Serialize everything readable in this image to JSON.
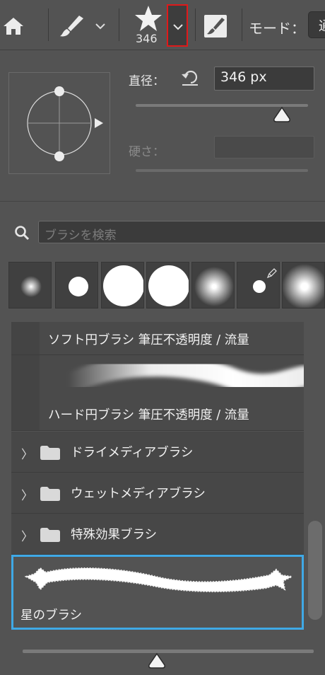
{
  "toolbar": {
    "preset_size": "346",
    "mode_label": "モード：",
    "mode_value": "通"
  },
  "brush_settings": {
    "size_label": "直径：",
    "size_value": "346 px",
    "size_slider_fraction": 0.85,
    "hardness_label": "硬さ：",
    "hardness_value": ""
  },
  "search": {
    "placeholder": "ブラシを検索"
  },
  "thumbnails": [
    {
      "name": "soft-round-small"
    },
    {
      "name": "hard-round-small"
    },
    {
      "name": "hard-round-large"
    },
    {
      "name": "hard-round-large-2"
    },
    {
      "name": "soft-round-medium"
    },
    {
      "name": "pressure-round"
    },
    {
      "name": "soft-round-large"
    }
  ],
  "presets": {
    "soft_round": "ソフト円ブラシ 筆圧不透明度 / 流量",
    "hard_round": "ハード円ブラシ 筆圧不透明度 / 流量",
    "groups": [
      {
        "label": "ドライメディアブラシ"
      },
      {
        "label": "ウェットメディアブラシ"
      },
      {
        "label": "特殊効果ブラシ"
      }
    ],
    "selected": "星のブラシ"
  },
  "colors": {
    "selection": "#3fa9e6",
    "highlight": "#e0191a"
  }
}
